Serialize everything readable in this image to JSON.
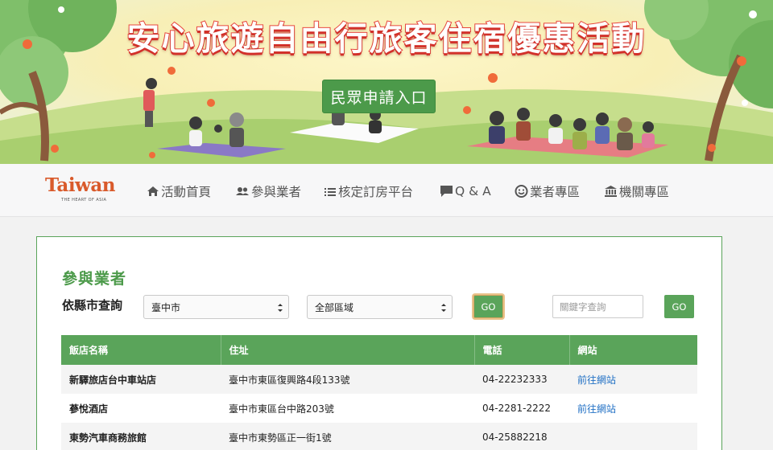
{
  "banner": {
    "title": "安心旅遊自由行旅客住宿優惠活動",
    "apply_button": "民眾申請入口"
  },
  "nav": {
    "logo_main": "Taiwan",
    "logo_sub": "THE HEART OF ASIA",
    "items": [
      {
        "label": "活動首頁",
        "icon": "home-icon"
      },
      {
        "label": "參與業者",
        "icon": "users-icon"
      },
      {
        "label": "核定訂房平台",
        "icon": "list-icon"
      },
      {
        "label": "Q & A",
        "icon": "comment-icon"
      },
      {
        "label": "業者專區",
        "icon": "smile-icon"
      },
      {
        "label": "機關專區",
        "icon": "bank-icon"
      }
    ]
  },
  "main": {
    "title": "參與業者",
    "filter_label": "依縣市查詢",
    "city_select": "臺中市",
    "district_select": "全部區域",
    "go_label": "GO",
    "keyword_placeholder": "關鍵字查詢",
    "table": {
      "headers": [
        "飯店名稱",
        "住址",
        "電話",
        "網站"
      ],
      "rows": [
        [
          "新驛旅店台中車站店",
          "臺中市東區復興路4段133號",
          "04-22232333",
          "前往網站"
        ],
        [
          "蔘悅酒店",
          "臺中市東區台中路203號",
          "04-2281-2222",
          "前往網站"
        ],
        [
          "東勢汽車商務旅館",
          "臺中市東勢區正一街1號",
          "04-25882218",
          ""
        ]
      ]
    }
  },
  "colors": {
    "accent_green": "#5aa45a",
    "title_red": "#e8473d",
    "link_blue": "#1f6fc4"
  }
}
